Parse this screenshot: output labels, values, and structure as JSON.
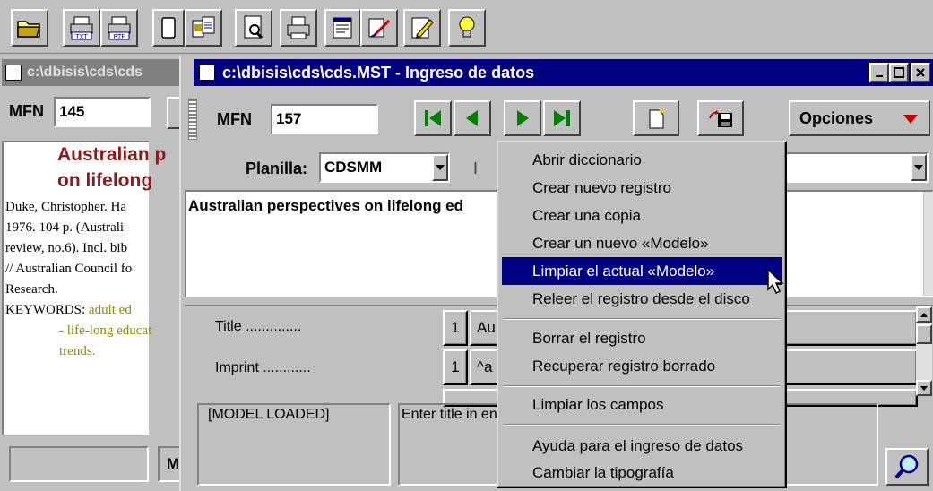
{
  "toolbar": {
    "buttons": [
      {
        "name": "open-folder-button",
        "icon": "folder-icon"
      },
      {
        "name": "export-txt-button",
        "icon": "printer-txt-icon",
        "label": "TXT"
      },
      {
        "name": "export-rtf-button",
        "icon": "printer-rtf-icon",
        "label": "RTF"
      },
      {
        "name": "new-document-button",
        "icon": "document-icon"
      },
      {
        "name": "copy-document-button",
        "icon": "copy-document-icon"
      },
      {
        "name": "preview-button",
        "icon": "magnify-page-icon"
      },
      {
        "name": "print-button",
        "icon": "printer-icon"
      },
      {
        "name": "form-button",
        "icon": "form-icon"
      },
      {
        "name": "edit-button",
        "icon": "pen-page-icon"
      },
      {
        "name": "write-button",
        "icon": "pencil-icon"
      },
      {
        "name": "tip-button",
        "icon": "lightbulb-icon"
      }
    ]
  },
  "back_window": {
    "title": "c:\\dbisis\\cds\\cds",
    "mfn_label": "MFN",
    "mfn_value": "145",
    "record_title_line1": "Australian p",
    "record_title_line2": "on lifelong",
    "record_text": [
      "Duke, Christopher. Ha",
      "1976. 104 p. (Australi",
      "review, no.6). Incl. bib",
      "// Australian Council fo",
      "Research."
    ],
    "keywords_label": "KEYWORDS:",
    "keywords_value": "adult ed",
    "keywords_cont1": "- life-long educat",
    "keywords_cont2": "trends.",
    "bottom_letter": "M"
  },
  "main_window": {
    "title": "c:\\dbisis\\cds\\cds.MST - Ingreso de datos",
    "mfn_label": "MFN",
    "mfn_value": "157",
    "opciones_label": "Opciones",
    "planilla_label": "Planilla:",
    "planilla_value": "CDSMM",
    "second_select_letter": "I",
    "editor_text": "Australian perspectives on lifelong ed",
    "fields": [
      {
        "label": "Title ..............",
        "occ": "1",
        "value": "Au"
      },
      {
        "label": "Imprint ............",
        "occ": "1",
        "value": "^a"
      }
    ],
    "status_left": "[MODEL LOADED]",
    "status_right": "Enter title in en"
  },
  "context_menu": {
    "items": [
      {
        "label": "Abrir diccionario",
        "highlighted": false
      },
      {
        "label": "Crear nuevo registro",
        "highlighted": false
      },
      {
        "label": "Crear una copia",
        "highlighted": false
      },
      {
        "label": "Crear un nuevo «Modelo»",
        "highlighted": false
      },
      {
        "label": "Limpiar el actual «Modelo»",
        "highlighted": true
      },
      {
        "label": "Releer el registro desde el disco",
        "highlighted": false
      },
      {
        "label": "Borrar el registro",
        "highlighted": false
      },
      {
        "label": "Recuperar registro borrado",
        "highlighted": false
      },
      {
        "label": "Limpiar los campos",
        "highlighted": false
      },
      {
        "label": "Ayuda para el ingreso de datos",
        "highlighted": false
      },
      {
        "label": "Cambiar la tipografía",
        "highlighted": false
      }
    ]
  },
  "colors": {
    "title_active": "#000080",
    "title_inactive": "#808080",
    "record_title": "#8b1a1a",
    "keyword_text": "#8b8b00",
    "nav_green": "#008000"
  }
}
